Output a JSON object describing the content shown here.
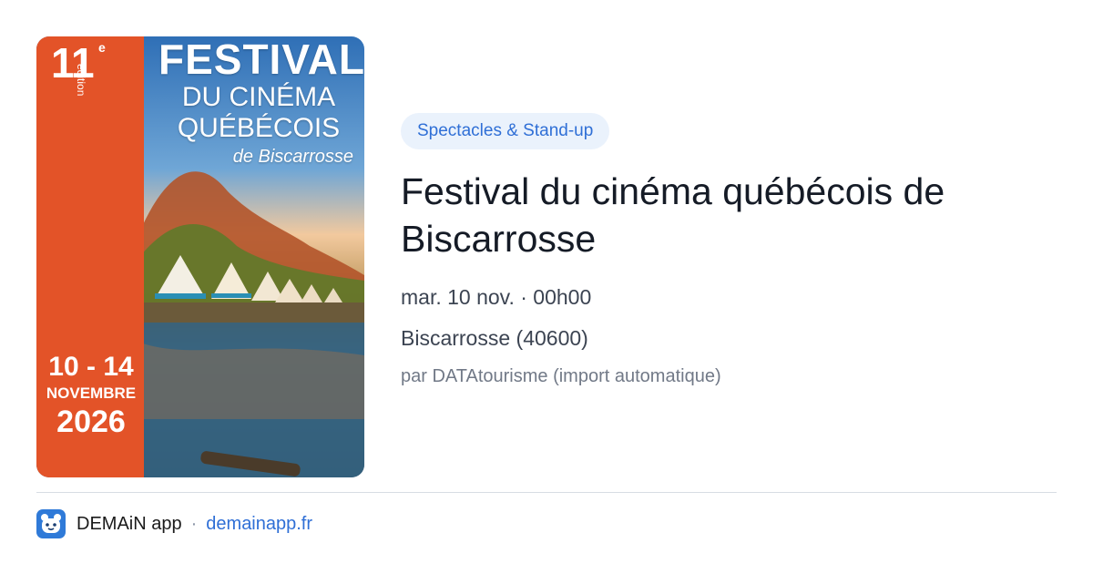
{
  "poster": {
    "edition_number": "11",
    "edition_sup": "e",
    "edition_word": "édition",
    "title_line1": "FESTIVAL",
    "title_line2": "DU CINÉMA",
    "title_line3": "QUÉBÉCOIS",
    "title_line4": "de Biscarrosse",
    "dates_line1": "10 - 14",
    "dates_line2": "NOVEMBRE",
    "dates_line3": "2026",
    "band_color": "#e35328"
  },
  "event": {
    "category": "Spectacles & Stand-up",
    "title": "Festival du cinéma québécois de Biscarrosse",
    "datetime": "mar. 10 nov. · 00h00",
    "location": "Biscarrosse (40600)",
    "source": "par DATAtourisme (import automatique)"
  },
  "footer": {
    "app_name": "DEMAiN app",
    "separator": "·",
    "domain": "demainapp.fr",
    "logo_icon": "bear-face-icon",
    "accent": "#2f6fd6"
  }
}
